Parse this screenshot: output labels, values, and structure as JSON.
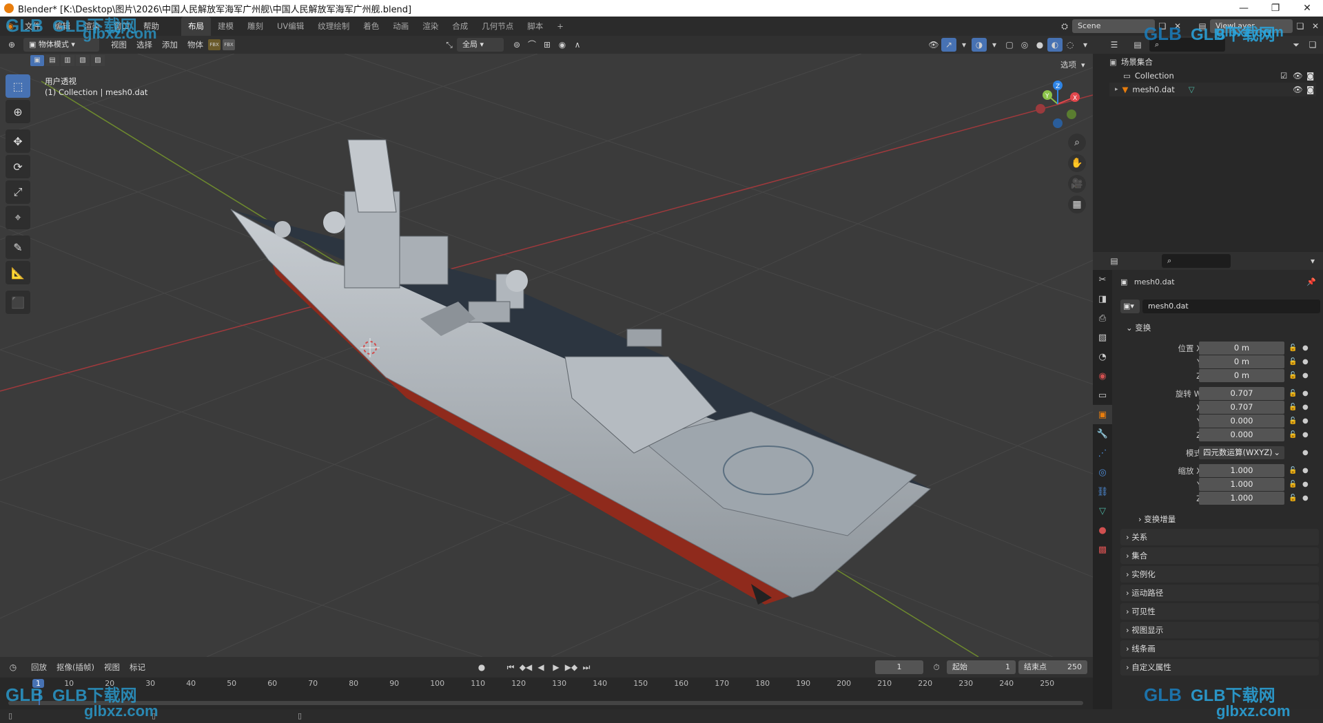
{
  "window": {
    "title": "Blender* [K:\\Desktop\\图片\\2026\\中国人民解放军海军广州舰\\中国人民解放军海军广州舰.blend]",
    "controls": [
      "—",
      "❐",
      "✕"
    ]
  },
  "menubar": {
    "menus": [
      "文件",
      "编辑",
      "渲染",
      "窗口",
      "帮助"
    ],
    "workspaces": [
      "布局",
      "建模",
      "雕刻",
      "UV编辑",
      "纹理绘制",
      "着色",
      "动画",
      "渲染",
      "合成",
      "几何节点",
      "脚本"
    ],
    "active_workspace": "布局",
    "add_tab": "+",
    "scene": "Scene",
    "view_layer": "ViewLayer"
  },
  "viewport_header": {
    "mode": "物体模式",
    "menus": [
      "视图",
      "选择",
      "添加",
      "物体"
    ],
    "orientation": "全局",
    "options": "选项"
  },
  "viewport": {
    "view_name": "用户透视",
    "collection_info": "(1) Collection | mesh0.dat",
    "gizmo_axes": [
      "X",
      "Y",
      "Z"
    ],
    "axis_colors": {
      "x": "#e0474c",
      "y": "#8bc34a",
      "z": "#2e84e6"
    },
    "grid_color": "#454545"
  },
  "outliner": {
    "root": "场景集合",
    "items": [
      {
        "name": "Collection"
      },
      {
        "name": "mesh0.dat"
      }
    ]
  },
  "properties": {
    "object_name": "mesh0.dat",
    "datablock": "mesh0.dat",
    "transform_label": "变换",
    "location": {
      "label": "位置 X",
      "x": "0 m",
      "y": "0 m",
      "z": "0 m"
    },
    "rotation": {
      "label": "旋转 W",
      "w": "0.707",
      "x": "0.707",
      "y": "0.000",
      "z": "0.000"
    },
    "mode": {
      "label": "模式",
      "value": "四元数运算(WXYZ)"
    },
    "scale": {
      "label": "缩放 X",
      "x": "1.000",
      "y": "1.000",
      "z": "1.000"
    },
    "axis_labels": {
      "x": "X",
      "y": "Y",
      "z": "Z"
    },
    "delta": "变换增量",
    "panels": [
      "关系",
      "集合",
      "实例化",
      "运动路径",
      "可见性",
      "视图显示",
      "线条画",
      "自定义属性"
    ]
  },
  "timeline": {
    "menus": [
      "回放",
      "抠像(插帧)",
      "视图",
      "标记"
    ],
    "current_frame": "1",
    "start_label": "起始",
    "start": "1",
    "end_label": "结束点",
    "end": "250",
    "ticks": [
      "1",
      "10",
      "20",
      "30",
      "40",
      "50",
      "60",
      "70",
      "80",
      "90",
      "100",
      "110",
      "120",
      "130",
      "140",
      "150",
      "160",
      "170",
      "180",
      "190",
      "200",
      "210",
      "220",
      "230",
      "240",
      "250"
    ]
  },
  "watermark": {
    "brand": "GLB下载网",
    "url": "glbxz.com",
    "logo": "GLB"
  }
}
